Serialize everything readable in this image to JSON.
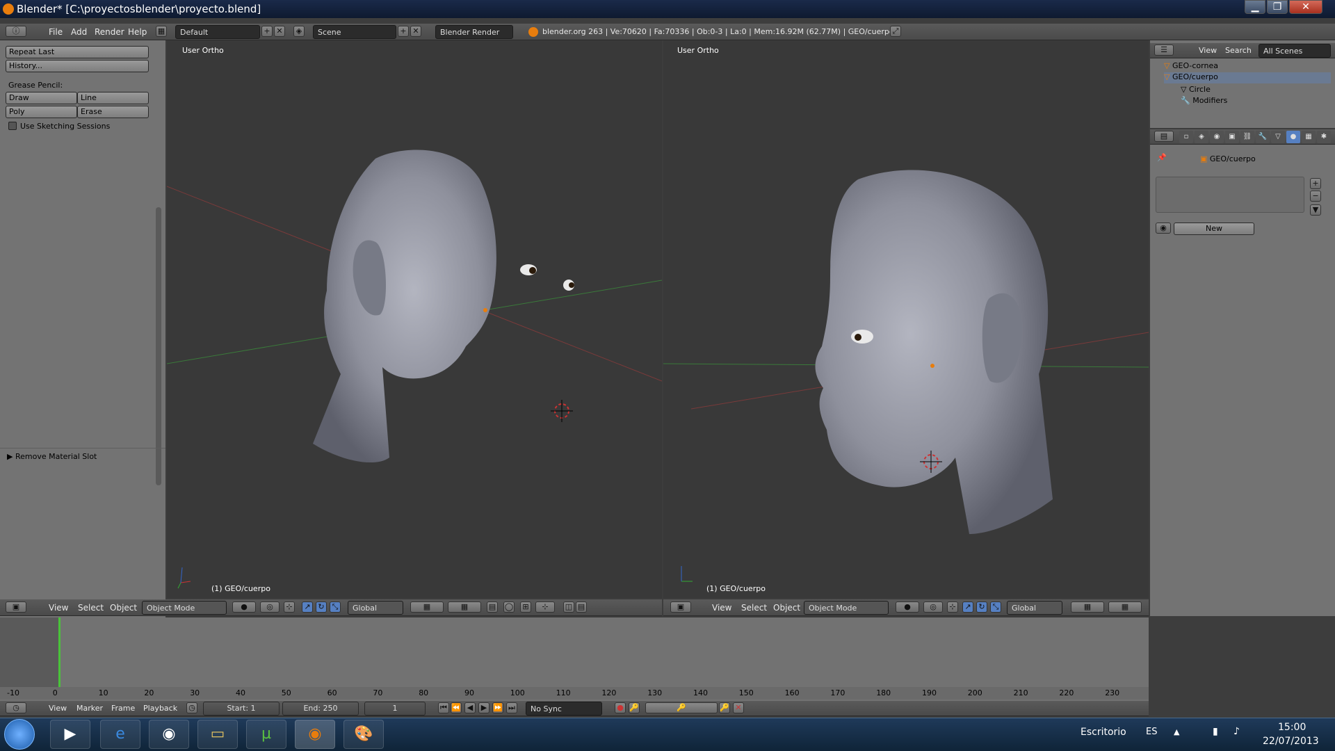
{
  "window": {
    "title": "Blender* [C:\\proyectosblender\\proyecto.blend]",
    "minimize": "▁",
    "maximize": "❐",
    "close": "✕"
  },
  "info_header": {
    "menus": [
      "File",
      "Add",
      "Render",
      "Help"
    ],
    "layout": "Default",
    "scene": "Scene",
    "engine": "Blender Render",
    "stats": "blender.org 263 | Ve:70620 | Fa:70336 | Ob:0-3 | La:0 | Mem:16.92M (62.77M) | GEO/cuerpo"
  },
  "toolshelf": {
    "repeat_last": "Repeat Last",
    "history": "History...",
    "grease_pencil": "Grease Pencil:",
    "draw": "Draw",
    "line": "Line",
    "poly": "Poly",
    "erase": "Erase",
    "use_sketching": "Use Sketching Sessions",
    "operator_panel": "Remove Material Slot"
  },
  "viewport_left": {
    "label": "User Ortho",
    "object": "(1) GEO/cuerpo",
    "header": {
      "view": "View",
      "select": "Select",
      "object": "Object",
      "mode": "Object Mode",
      "orientation": "Global"
    }
  },
  "viewport_right": {
    "label": "User Ortho",
    "object": "(1) GEO/cuerpo",
    "header": {
      "view": "View",
      "select": "Select",
      "object": "Object",
      "mode": "Object Mode",
      "orientation": "Global"
    }
  },
  "outliner": {
    "header": {
      "view": "View",
      "search": "Search",
      "scenes": "All Scenes"
    },
    "items": [
      "GEO-cornea",
      "GEO/cuerpo",
      "Circle",
      "Modifiers"
    ]
  },
  "properties": {
    "breadcrumb": "GEO/cuerpo",
    "new_button": "New"
  },
  "timeline": {
    "ticks": [
      "-10",
      "0",
      "10",
      "20",
      "30",
      "40",
      "50",
      "60",
      "70",
      "80",
      "90",
      "100",
      "110",
      "120",
      "130",
      "140",
      "150",
      "160",
      "170",
      "180",
      "190",
      "200",
      "210",
      "220",
      "230"
    ],
    "menus": [
      "View",
      "Marker",
      "Frame",
      "Playback"
    ],
    "start": "Start: 1",
    "end": "End: 250",
    "current": "1",
    "sync": "No Sync"
  },
  "taskbar": {
    "desktop": "Escritorio",
    "lang": "ES",
    "time": "15:00",
    "date": "22/07/2013"
  },
  "colors": {
    "viewport_bg": "#393939",
    "panel_bg": "#727272",
    "header_bg": "#4f4f4f",
    "accent": "#5680c2",
    "mesh": "#8c8e99"
  }
}
